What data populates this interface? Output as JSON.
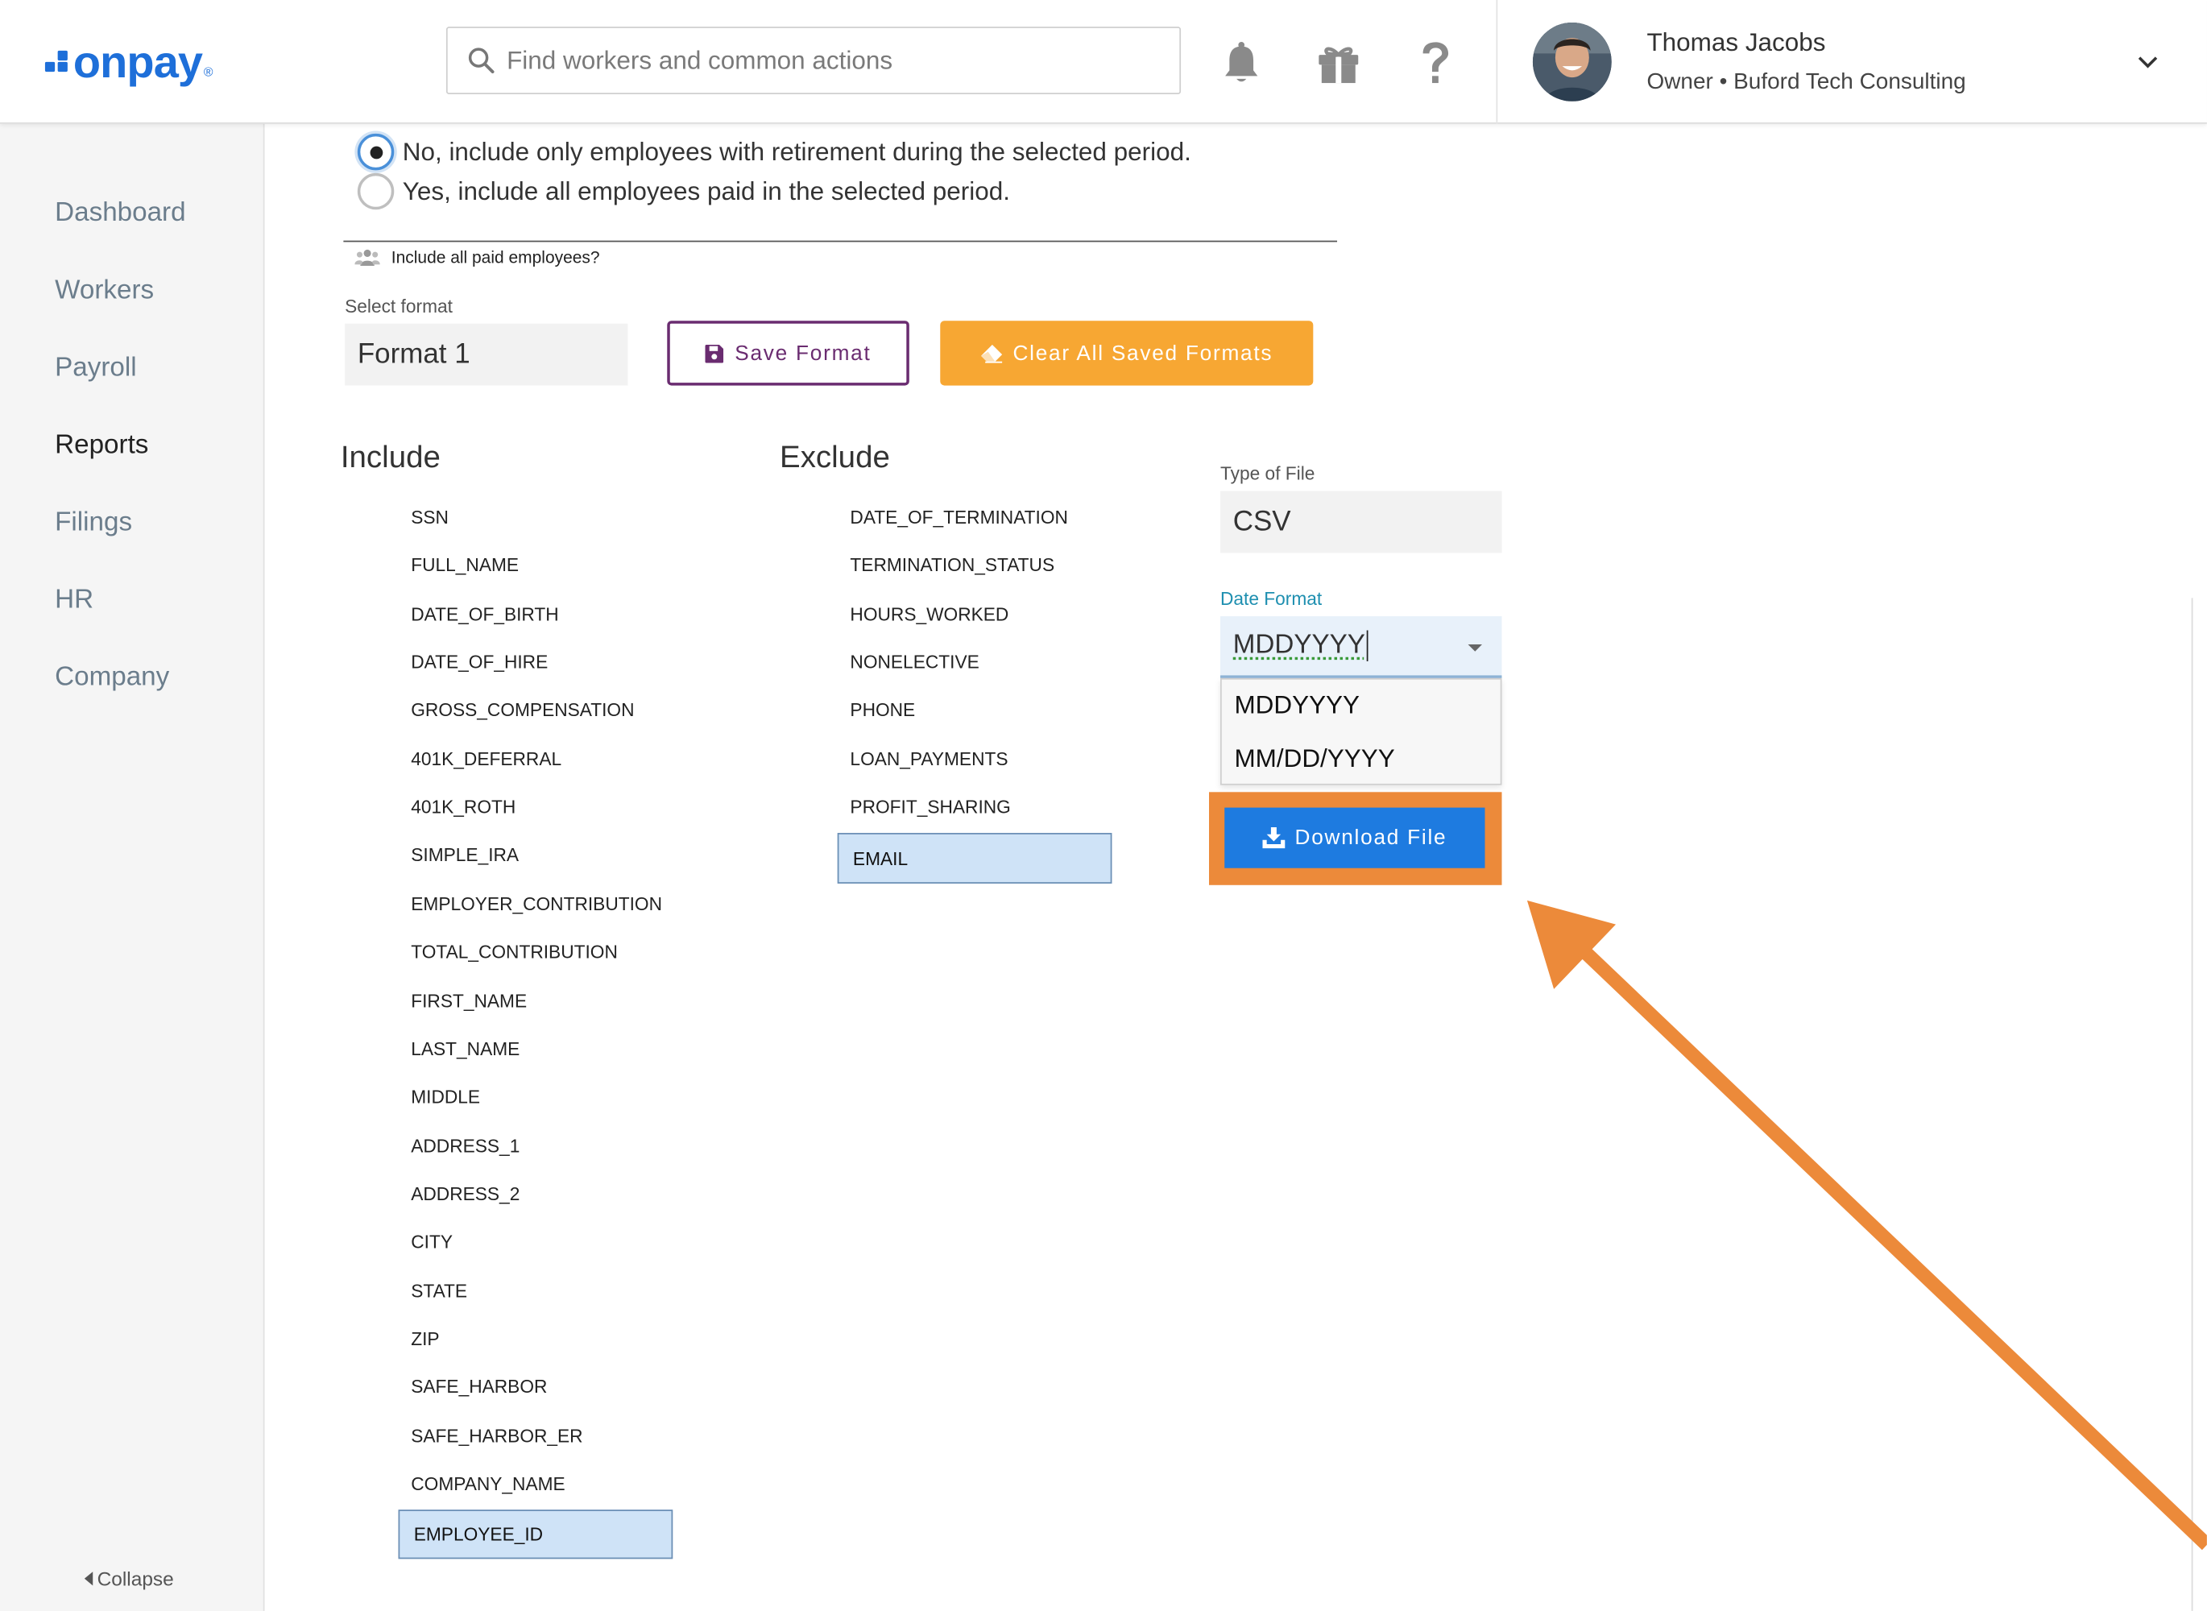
{
  "header": {
    "logo_text": "onpay",
    "logo_reg": "®",
    "search_placeholder": "Find workers and common actions",
    "user_name": "Thomas Jacobs",
    "user_role": "Owner • Buford Tech Consulting"
  },
  "sidebar": {
    "items": [
      {
        "label": "Dashboard",
        "active": false
      },
      {
        "label": "Workers",
        "active": false
      },
      {
        "label": "Payroll",
        "active": false
      },
      {
        "label": "Reports",
        "active": true
      },
      {
        "label": "Filings",
        "active": false
      },
      {
        "label": "HR",
        "active": false
      },
      {
        "label": "Company",
        "active": false
      }
    ],
    "collapse_label": "Collapse"
  },
  "options": {
    "radio_no": "No, include only employees with retirement during the selected period.",
    "radio_yes": "Yes, include all employees paid in the selected period.",
    "selected": "no",
    "hint": "Include all paid employees?"
  },
  "format": {
    "label": "Select format",
    "value": "Format 1",
    "save_label": "Save Format",
    "clear_label": "Clear All Saved Formats"
  },
  "include": {
    "title": "Include",
    "items": [
      "SSN",
      "FULL_NAME",
      "DATE_OF_BIRTH",
      "DATE_OF_HIRE",
      "GROSS_COMPENSATION",
      "401K_DEFERRAL",
      "401K_ROTH",
      "SIMPLE_IRA",
      "EMPLOYER_CONTRIBUTION",
      "TOTAL_CONTRIBUTION",
      "FIRST_NAME",
      "LAST_NAME",
      "MIDDLE",
      "ADDRESS_1",
      "ADDRESS_2",
      "CITY",
      "STATE",
      "ZIP",
      "SAFE_HARBOR",
      "SAFE_HARBOR_ER",
      "COMPANY_NAME"
    ],
    "selected": "EMPLOYEE_ID"
  },
  "exclude": {
    "title": "Exclude",
    "items": [
      "DATE_OF_TERMINATION",
      "TERMINATION_STATUS",
      "HOURS_WORKED",
      "NONELECTIVE",
      "PHONE",
      "LOAN_PAYMENTS",
      "PROFIT_SHARING"
    ],
    "selected": "EMAIL"
  },
  "file": {
    "type_label": "Type of File",
    "type_value": "CSV",
    "date_label": "Date Format",
    "date_value": "MDDYYYY",
    "date_options": [
      "MDDYYYY",
      "MM/DD/YYYY"
    ],
    "download_label": "Download File"
  },
  "colors": {
    "accent_blue": "#1e7be0",
    "save_purple": "#6a2c70",
    "clear_orange": "#f7a733",
    "highlight_orange": "#ec8a3a",
    "selected_bg": "#cfe3f7"
  },
  "icons": [
    "search-icon",
    "bell-icon",
    "gift-icon",
    "help-icon",
    "chevron-down-icon",
    "people-icon",
    "save-icon",
    "eraser-icon",
    "download-icon",
    "caret-left-icon"
  ]
}
